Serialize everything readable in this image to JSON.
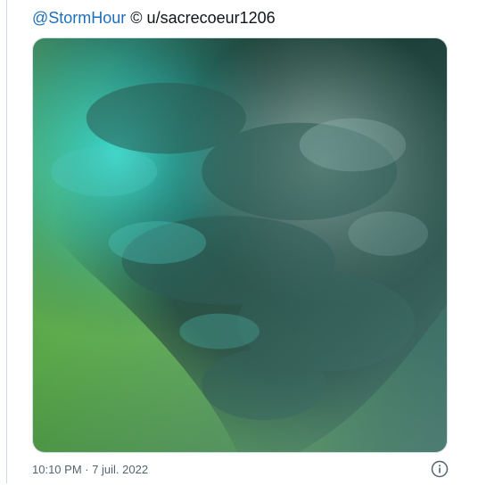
{
  "tweet": {
    "mention": "@StormHour",
    "credit": " © u/sacrecoeur1206",
    "media": {
      "icon": "storm-cloud-photo",
      "colors": {
        "green_sky": "#5fae4c",
        "cloud_dark": "#20463f",
        "cloud_teal": "#35d6cc",
        "cloud_light": "#a9c8c3"
      }
    },
    "timestamp": "10:10 PM · 7 juil. 2022",
    "info_icon": "info-icon"
  },
  "colors": {
    "link": "#1d6fb8",
    "text": "#0f1419",
    "muted": "#536471"
  }
}
